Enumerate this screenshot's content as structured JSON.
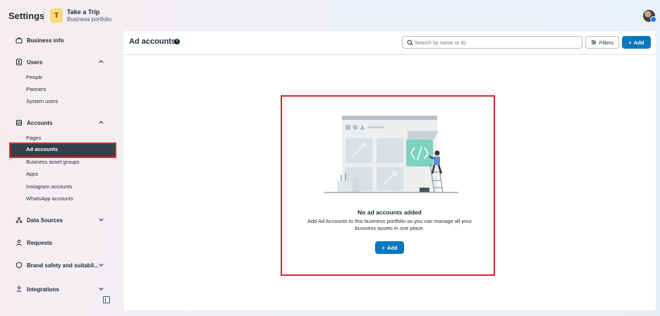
{
  "topbar": {
    "app_title": "Settings",
    "portfolio_initial": "T",
    "portfolio_name": "Take a Trip",
    "portfolio_type": "Business portfolio"
  },
  "sidebar": {
    "business_info": "Business info",
    "users": {
      "label": "Users",
      "items": [
        "People",
        "Partners",
        "System users"
      ]
    },
    "accounts": {
      "label": "Accounts",
      "items": [
        "Pages",
        "Ad accounts",
        "Business asset groups",
        "Apps",
        "Instagram accounts",
        "WhatsApp accounts"
      ],
      "active": "Ad accounts"
    },
    "data_sources": "Data Sources",
    "requests": "Requests",
    "brand_safety": "Brand safety and suitabil...",
    "integrations": "Integrations"
  },
  "main": {
    "title": "Ad accounts",
    "search_placeholder": "Search by name or ID",
    "filters_label": "Filters",
    "add_label": "Add",
    "empty_state": {
      "title": "No ad accounts added",
      "description": "Add Ad Accounts to this business portfolio so you can manage all your business assets in one place.",
      "add_label": "Add"
    }
  },
  "colors": {
    "primary": "#0a78be",
    "active_nav": "#34414a",
    "highlight": "#d8232a",
    "portfolio_avatar": "#fbd97a",
    "illustration_accent": "#7fd1c0"
  }
}
